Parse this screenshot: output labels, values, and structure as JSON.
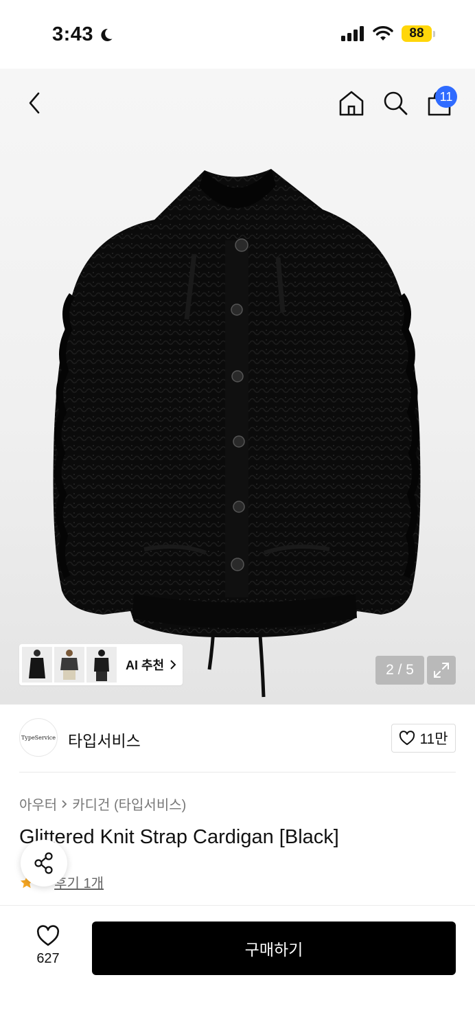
{
  "status_bar": {
    "time": "3:43",
    "battery": "88"
  },
  "nav": {
    "cart_count": "11"
  },
  "gallery": {
    "ai_label": "AI 추천",
    "pager": "2 / 5"
  },
  "brand": {
    "name": "타입서비스",
    "logo_text": "TypeService",
    "likes": "11만"
  },
  "product": {
    "breadcrumb": [
      "아우터",
      "카디건 (타입서비스)"
    ],
    "title": "Glittered Knit Strap Cardigan [Black]",
    "rating": "5",
    "review_link": "후기 1개"
  },
  "bottom_bar": {
    "wish_count": "627",
    "buy_label": "구매하기"
  },
  "colors": {
    "accent_blue": "#2f6bff",
    "battery_yellow": "#ffd60a",
    "star_orange": "#f5a623",
    "buy_black": "#000000"
  }
}
